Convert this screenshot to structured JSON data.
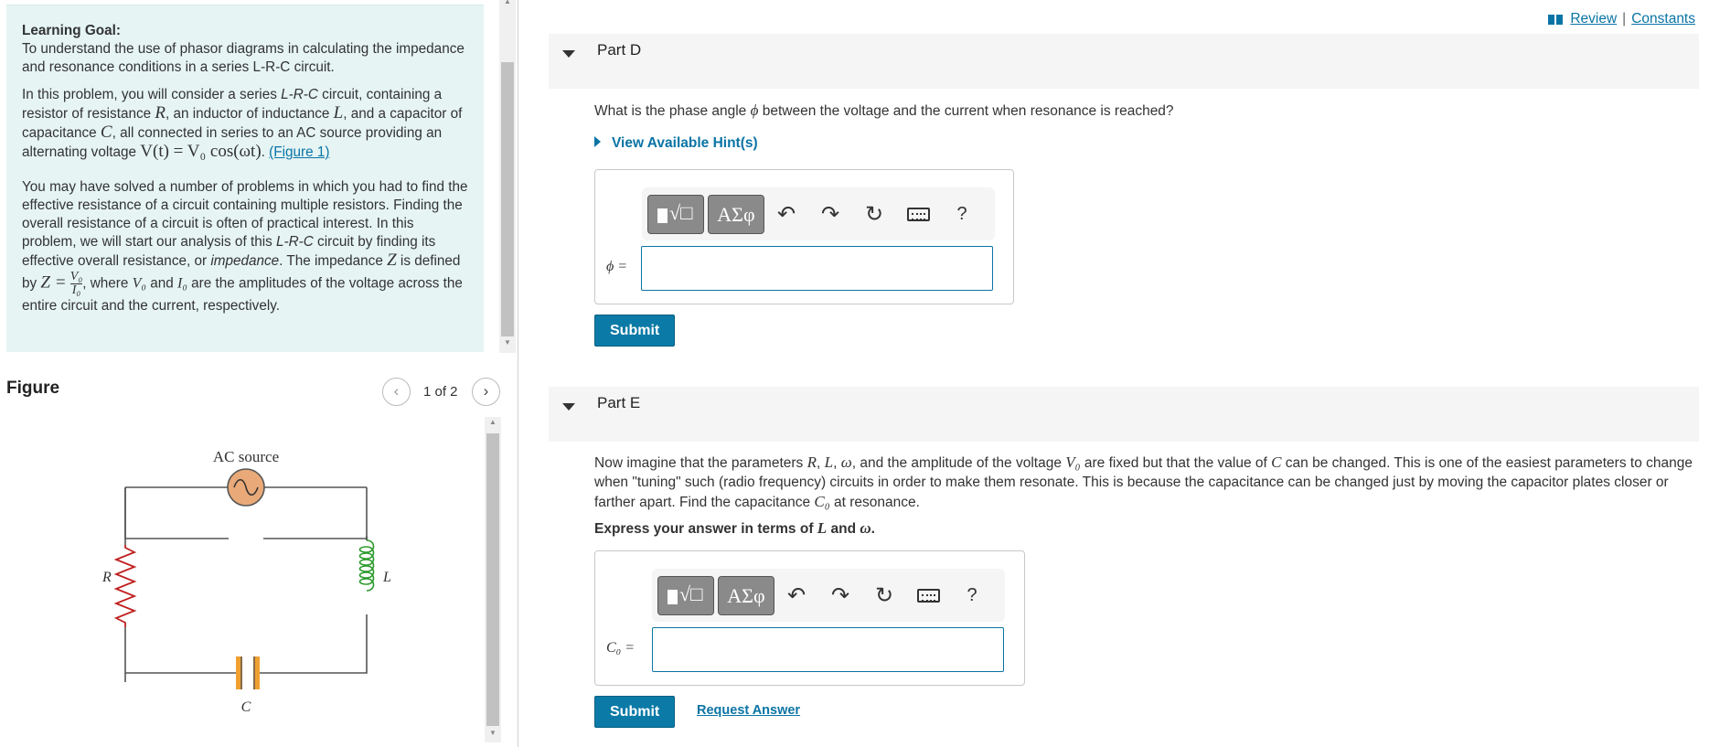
{
  "goal": {
    "title": "Learning Goal:",
    "objective": "To understand the use of phasor diagrams in calculating the impedance and resonance conditions in a series L-R-C circuit.",
    "p1_a": "In this problem, you will consider a series",
    "p1_lrc": "L-R-C",
    "p1_b": "circuit, containing a resistor of resistance",
    "p1_c": ", an inductor of inductance",
    "p1_d": ", and a capacitor of capacitance",
    "p1_e": ", all connected in series to an AC source providing an alternating voltage",
    "p1_eq": "V(t) = V₀ cos(ωt)",
    "figure_link": "(Figure 1)",
    "p2_a": "You may have solved a number of problems in which you had to find the effective resistance of a circuit containing multiple resistors. Finding the overall resistance of a circuit is often of practical interest. In this problem, we will start our analysis of this",
    "p2_lrc": "L-R-C",
    "p2_b": "circuit by finding its effective overall resistance, or",
    "p2_imp": "impedance",
    "p2_c": ". The impedance",
    "p2_d": "is defined by",
    "p2_e": ", where",
    "p2_and": "and",
    "p2_f": "are the amplitudes of the voltage across the entire circuit and the current, respectively.",
    "sym_R": "R",
    "sym_L": "L",
    "sym_C": "C",
    "sym_Z": "Z",
    "eq_Z": "Z =",
    "sym_V0": "V₀",
    "sym_I0": "I₀"
  },
  "figure": {
    "title": "Figure",
    "count": "1 of 2",
    "prev": "‹",
    "next": "›",
    "ac_label": "AC source",
    "R_label": "R",
    "L_label": "L",
    "C_label": "C"
  },
  "nav": {
    "review": "Review",
    "sep": "|",
    "constants": "Constants"
  },
  "partD": {
    "title": "Part D",
    "question_a": "What is the phase angle",
    "question_sym": "ϕ",
    "question_b": "between the voltage and the current when resonance is reached?",
    "hint": "View Available Hint(s)",
    "label": "ϕ =",
    "submit": "Submit",
    "toolbar": {
      "symbols": "ΑΣφ",
      "help": "?"
    }
  },
  "partE": {
    "title": "Part E",
    "q_a": "Now imagine that the parameters",
    "q_R": "R",
    "q_L": "L",
    "q_w": "ω",
    "q_b": ", and the amplitude of the voltage",
    "q_V0": "V₀",
    "q_c": "are fixed but that the value of",
    "q_C": "C",
    "q_d": "can be changed. This is one of the easiest parameters to change when \"tuning\" such (radio frequency) circuits in order to make them resonate. This is because the capacitance can be changed just by moving the capacitor plates closer or farther apart. Find the capacitance",
    "q_C0": "C₀",
    "q_e": "at resonance.",
    "instr_a": "Express your answer in terms of",
    "instr_L": "L",
    "instr_and": "and",
    "instr_w": "ω",
    "label": "C₀ =",
    "submit": "Submit",
    "request": "Request Answer",
    "toolbar": {
      "symbols": "ΑΣφ",
      "help": "?"
    }
  }
}
